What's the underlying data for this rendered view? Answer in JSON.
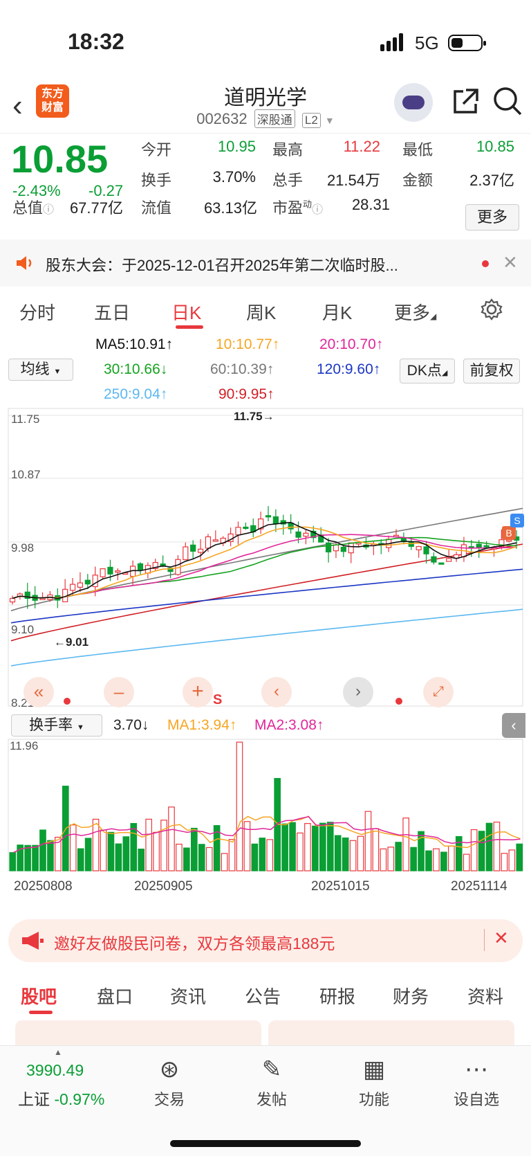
{
  "status": {
    "time": "18:32",
    "network": "5G",
    "battery_level": 0.4
  },
  "header": {
    "back": "‹",
    "logo": [
      "东方",
      "财富"
    ],
    "name": "道明光学",
    "code": "002632",
    "tags": [
      "深股通",
      "L2"
    ]
  },
  "quote": {
    "price": "10.85",
    "change_pct": "-2.43%",
    "change": "-0.27",
    "rows": [
      [
        {
          "label": "今开",
          "value": "10.95",
          "color": "green"
        },
        {
          "label": "最高",
          "value": "11.22",
          "color": "red"
        },
        {
          "label": "最低",
          "value": "10.85",
          "color": "green"
        }
      ],
      [
        {
          "label": "换手",
          "value": "3.70%",
          "color": "plain"
        },
        {
          "label": "总手",
          "value": "21.54万",
          "color": "plain"
        },
        {
          "label": "金额",
          "value": "2.37亿",
          "color": "plain"
        }
      ]
    ],
    "total_value_label": "总值",
    "total_value": "67.77亿",
    "float_label": "流值",
    "float_value": "63.13亿",
    "pe_label": "市盈",
    "pe_sup": "动",
    "pe_value": "28.31",
    "more": "更多"
  },
  "notice": {
    "text": "股东大会：于2025-12-01召开2025年第二次临时股..."
  },
  "tabs": [
    {
      "label": "分时",
      "active": false
    },
    {
      "label": "五日",
      "active": false
    },
    {
      "label": "日K",
      "active": true
    },
    {
      "label": "周K",
      "active": false
    },
    {
      "label": "月K",
      "active": false
    },
    {
      "label": "更多",
      "active": false
    }
  ],
  "ma_legend": {
    "selector": "均线",
    "dk": "DK点",
    "adjust": "前复权",
    "items": [
      {
        "text": "MA5:10.91↑",
        "color": "#111111"
      },
      {
        "text": "10:10.77↑",
        "color": "#f5a623"
      },
      {
        "text": "20:10.70↑",
        "color": "#e0269a"
      },
      {
        "text": "30:10.66↓",
        "color": "#14a31e"
      },
      {
        "text": "60:10.39↑",
        "color": "#777777"
      },
      {
        "text": "120:9.60↑",
        "color": "#1c36c4"
      },
      {
        "text": "250:9.04↑",
        "color": "#5cb8f0"
      },
      {
        "text": "90:9.95↑",
        "color": "#d01f26"
      }
    ]
  },
  "kchart": {
    "y_labels": [
      "11.75",
      "10.87",
      "9.98",
      "9.10",
      "8.21"
    ],
    "high_marker": "11.75",
    "low_marker": "9.01",
    "markers": [
      "S",
      "B"
    ]
  },
  "volume": {
    "selector": "换手率",
    "current": "3.70↓",
    "ma1": "MA1:3.94↑",
    "ma2": "MA2:3.08↑",
    "y_label": "11.96",
    "dates": [
      "20250808",
      "20250905",
      "20251015",
      "20251114"
    ]
  },
  "chart_data": {
    "type": "candlestick",
    "y_range": [
      8.21,
      11.75
    ],
    "volume_max": 11.96,
    "candles_note": "daily K-line with turnover rate sub-chart"
  },
  "colors": {
    "up": "#e8383d",
    "down": "#0a9e35",
    "accent": "#f25c1c"
  },
  "promo": {
    "text": "邀好友做股民问卷，双方各领最高188元"
  },
  "bottom_tabs": [
    "股吧",
    "盘口",
    "资讯",
    "公告",
    "研报",
    "财务",
    "资料"
  ],
  "footer": {
    "index_value": "3990.49",
    "index_name": "上证",
    "index_change": "-0.97%",
    "items": [
      {
        "label": "交易",
        "icon": "trade-icon"
      },
      {
        "label": "发帖",
        "icon": "post-icon"
      },
      {
        "label": "功能",
        "icon": "function-icon"
      },
      {
        "label": "设自选",
        "icon": "more-icon"
      }
    ]
  }
}
